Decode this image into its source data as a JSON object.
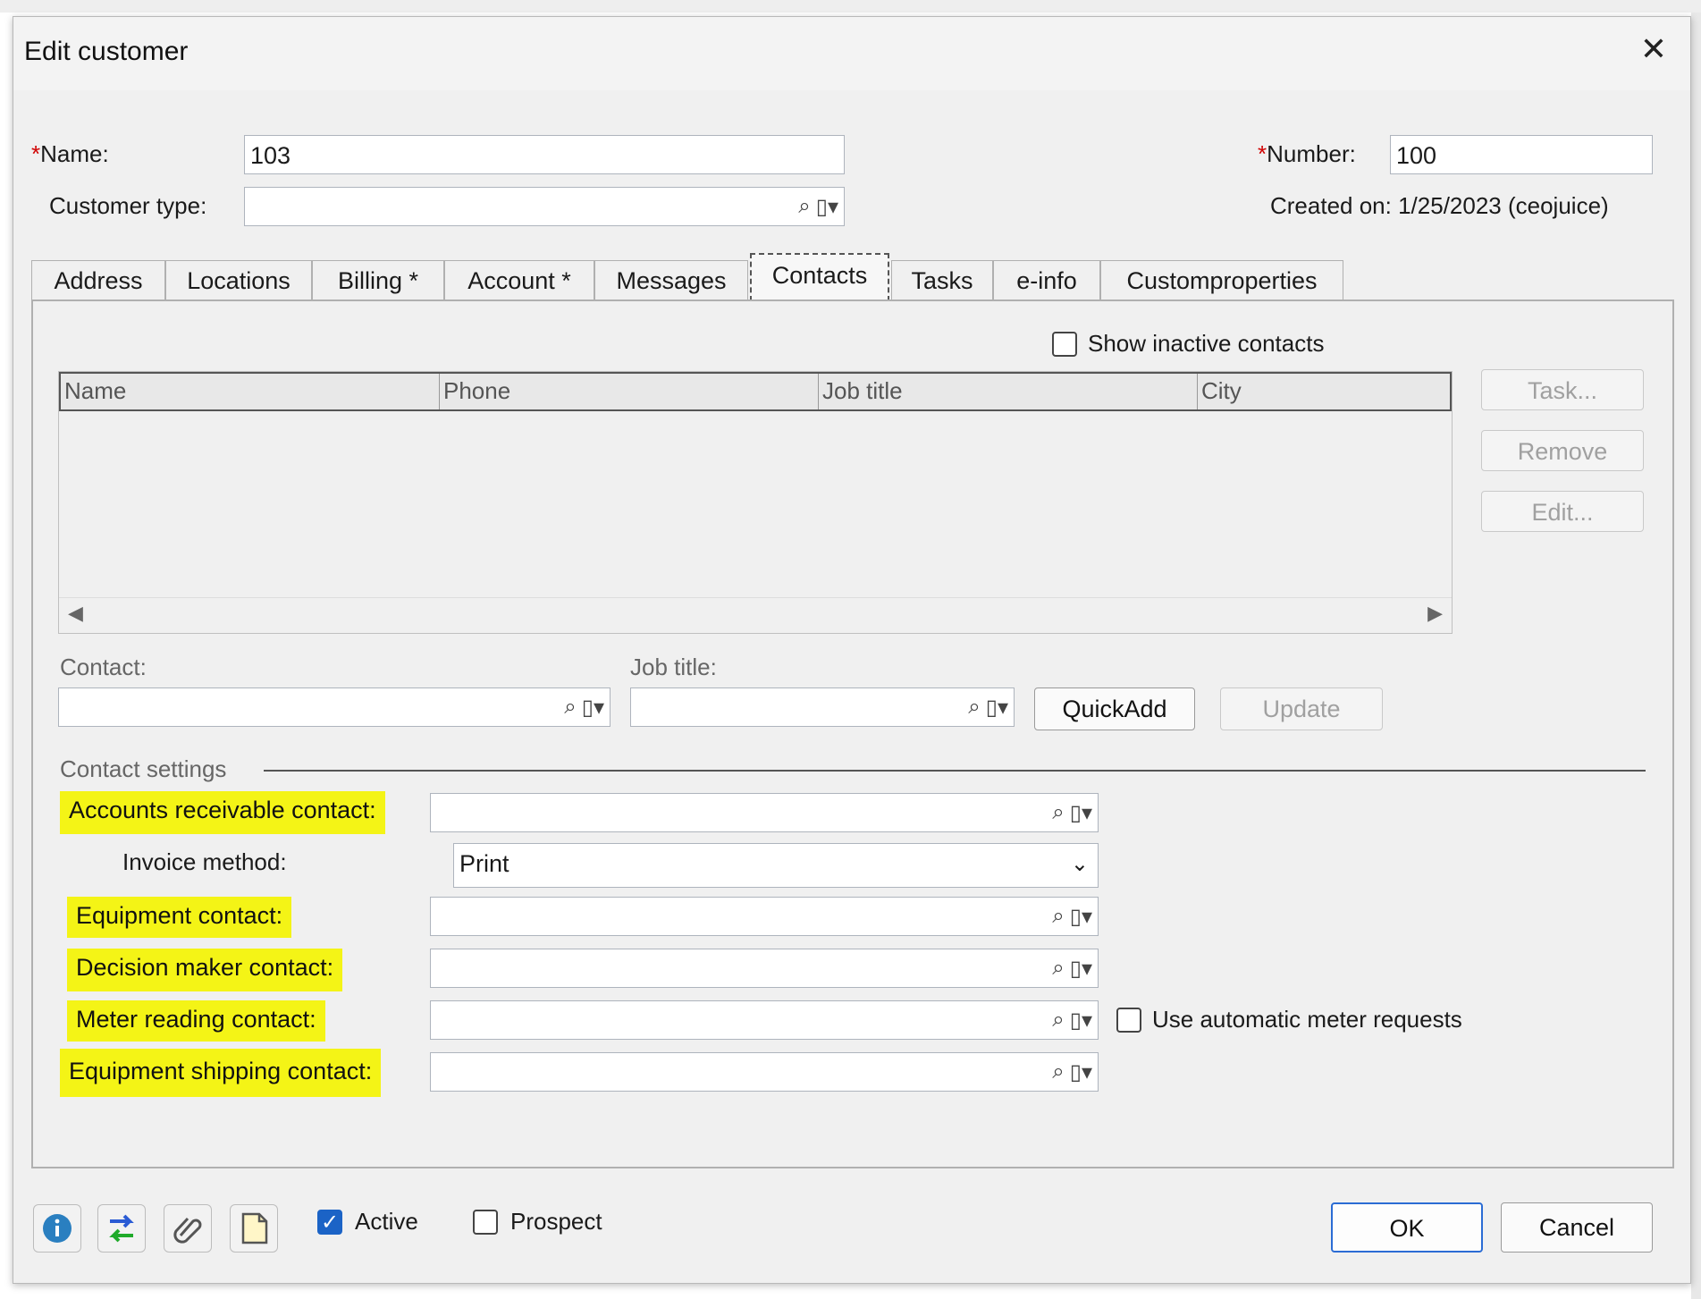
{
  "dialog": {
    "title": "Edit customer",
    "close_glyph": "✕"
  },
  "header": {
    "name_required_mark": "*",
    "name_label": "Name:",
    "name_value": "103",
    "number_required_mark": "*",
    "number_label": "Number:",
    "number_value": "100",
    "customer_type_label": "Customer type:",
    "customer_type_value": "",
    "created_on_text": "Created on: 1/25/2023 (ceojuice)"
  },
  "tabs": [
    {
      "label": "Address"
    },
    {
      "label": "Locations"
    },
    {
      "label": "Billing  *"
    },
    {
      "label": "Account *"
    },
    {
      "label": "Messages"
    },
    {
      "label": "Contacts",
      "active": true
    },
    {
      "label": "Tasks"
    },
    {
      "label": "e-info"
    },
    {
      "label": "Customproperties"
    }
  ],
  "contacts": {
    "show_inactive_label": "Show inactive contacts",
    "show_inactive_checked": false,
    "grid_columns": [
      "Name",
      "Phone",
      "Job title",
      "City"
    ],
    "grid_rows": [],
    "side_buttons": {
      "task": "Task...",
      "remove": "Remove",
      "edit": "Edit..."
    },
    "contact_label": "Contact:",
    "contact_value": "",
    "job_title_label": "Job title:",
    "job_title_value": "",
    "quickadd_label": "QuickAdd",
    "update_label": "Update"
  },
  "contact_settings": {
    "section_label": "Contact settings",
    "accounts_receivable_label": "Accounts receivable contact:",
    "accounts_receivable_value": "",
    "invoice_method_label": "Invoice method:",
    "invoice_method_value": "Print",
    "equipment_label": "Equipment contact:",
    "equipment_value": "",
    "decision_maker_label": "Decision maker contact:",
    "decision_maker_value": "",
    "meter_reading_label": "Meter reading contact:",
    "meter_reading_value": "",
    "auto_meter_label": "Use automatic meter requests",
    "auto_meter_checked": false,
    "equipment_shipping_label": "Equipment shipping contact:",
    "equipment_shipping_value": "",
    "highlight_color": "#f4f416"
  },
  "footer": {
    "icons": [
      "info-icon",
      "swap-arrows-icon",
      "attachment-icon",
      "document-icon"
    ],
    "active_label": "Active",
    "active_checked": true,
    "prospect_label": "Prospect",
    "prospect_checked": false,
    "ok_label": "OK",
    "cancel_label": "Cancel"
  }
}
